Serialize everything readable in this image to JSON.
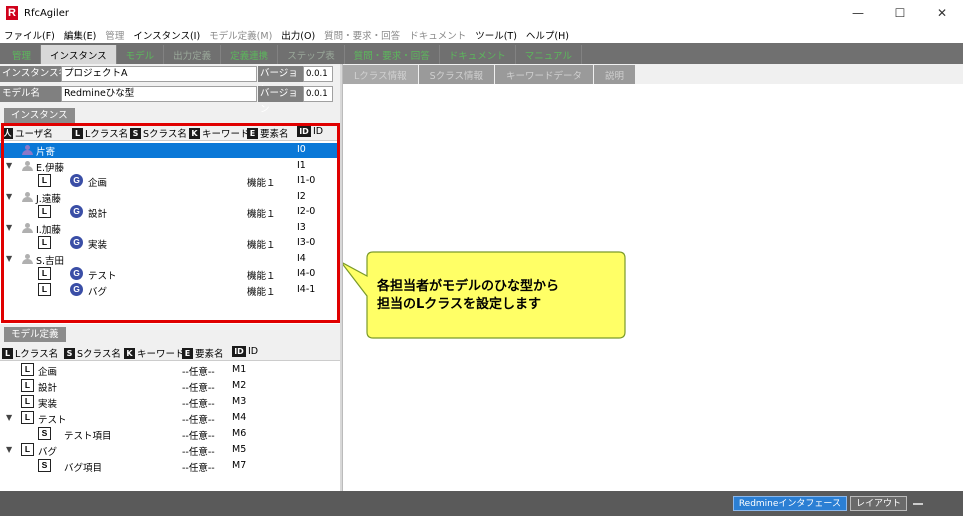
{
  "app": {
    "title": "RfcAgiler",
    "logo": "R"
  },
  "window_controls": {
    "minimize": "—",
    "maximize": "☐",
    "close": "✕"
  },
  "menu": [
    {
      "label": "ファイル(F)",
      "enabled": true
    },
    {
      "label": "編集(E)",
      "enabled": true
    },
    {
      "label": "管理",
      "enabled": false
    },
    {
      "label": "インスタンス(I)",
      "enabled": true
    },
    {
      "label": "モデル定義(M)",
      "enabled": false
    },
    {
      "label": "出力(O)",
      "enabled": true
    },
    {
      "label": "質問・要求・回答",
      "enabled": false
    },
    {
      "label": "ドキュメント",
      "enabled": false
    },
    {
      "label": "ツール(T)",
      "enabled": true
    },
    {
      "label": "ヘルプ(H)",
      "enabled": true
    }
  ],
  "tabs": [
    {
      "label": "管理",
      "style": "green"
    },
    {
      "label": "インスタンス",
      "style": "active"
    },
    {
      "label": "モデル",
      "style": "green"
    },
    {
      "label": "出力定義",
      "style": "dim"
    },
    {
      "label": "定義連携",
      "style": "green"
    },
    {
      "label": "ステップ表",
      "style": "dim"
    },
    {
      "label": "質問・要求・回答",
      "style": "green"
    },
    {
      "label": "ドキュメント",
      "style": "green"
    },
    {
      "label": "マニュアル",
      "style": "green"
    }
  ],
  "instance_form": {
    "instance_label": "インスタンス名",
    "instance_value": "プロジェクトA",
    "model_label": "モデル名",
    "model_value": "Redmineひな型",
    "version_label": "バージョン",
    "instance_version": "0.0.1",
    "model_version": "0.0.1"
  },
  "instance_section": {
    "tab_label": "インスタンス",
    "headers": {
      "user": {
        "icon": "人",
        "label": "ユーザ名"
      },
      "lclass": {
        "icon": "L",
        "label": "Lクラス名"
      },
      "sclass": {
        "icon": "S",
        "label": "Sクラス名"
      },
      "keyword": {
        "icon": "K",
        "label": "キーワード"
      },
      "element": {
        "icon": "E",
        "label": "要素名"
      },
      "id": {
        "icon": "ID",
        "label": "ID"
      }
    },
    "rows": [
      {
        "kind": "user",
        "name": "片寄",
        "id": "I0",
        "selected": true,
        "person": "purple",
        "expand": ""
      },
      {
        "kind": "user",
        "name": "E.伊藤",
        "id": "I1",
        "selected": false,
        "person": "grey",
        "expand": "▼"
      },
      {
        "kind": "item",
        "lclass": "L",
        "sclass": "G",
        "label": "企画",
        "element": "機能１",
        "id": "I1-0"
      },
      {
        "kind": "user",
        "name": "J.遠藤",
        "id": "I2",
        "selected": false,
        "person": "grey",
        "expand": "▼"
      },
      {
        "kind": "item",
        "lclass": "L",
        "sclass": "G",
        "label": "設計",
        "element": "機能１",
        "id": "I2-0"
      },
      {
        "kind": "user",
        "name": "I.加藤",
        "id": "I3",
        "selected": false,
        "person": "grey",
        "expand": "▼"
      },
      {
        "kind": "item",
        "lclass": "L",
        "sclass": "G",
        "label": "実装",
        "element": "機能１",
        "id": "I3-0"
      },
      {
        "kind": "user",
        "name": "S.吉田",
        "id": "I4",
        "selected": false,
        "person": "grey",
        "expand": "▼"
      },
      {
        "kind": "item",
        "lclass": "L",
        "sclass": "G",
        "label": "テスト",
        "element": "機能１",
        "id": "I4-0"
      },
      {
        "kind": "item",
        "lclass": "L",
        "sclass": "G",
        "label": "バグ",
        "element": "機能１",
        "id": "I4-1"
      }
    ]
  },
  "model_section": {
    "tab_label": "モデル定義",
    "headers": {
      "lclass": {
        "icon": "L",
        "label": "Lクラス名"
      },
      "sclass": {
        "icon": "S",
        "label": "Sクラス名"
      },
      "keyword": {
        "icon": "K",
        "label": "キーワード"
      },
      "element": {
        "icon": "E",
        "label": "要素名"
      },
      "id": {
        "icon": "ID",
        "label": "ID"
      }
    },
    "rows": [
      {
        "kind": "l",
        "label": "企画",
        "element": "--任意--",
        "id": "M1",
        "expand": ""
      },
      {
        "kind": "l",
        "label": "設計",
        "element": "--任意--",
        "id": "M2",
        "expand": ""
      },
      {
        "kind": "l",
        "label": "実装",
        "element": "--任意--",
        "id": "M3",
        "expand": ""
      },
      {
        "kind": "l",
        "label": "テスト",
        "element": "--任意--",
        "id": "M4",
        "expand": "▼"
      },
      {
        "kind": "s",
        "label": "テスト項目",
        "element": "--任意--",
        "id": "M6",
        "expand": ""
      },
      {
        "kind": "l",
        "label": "バグ",
        "element": "--任意--",
        "id": "M5",
        "expand": "▼"
      },
      {
        "kind": "s",
        "label": "バグ項目",
        "element": "--任意--",
        "id": "M7",
        "expand": ""
      }
    ]
  },
  "right_tabs": [
    "Lクラス情報",
    "Sクラス情報",
    "キーワードデータ",
    "説明"
  ],
  "callout": {
    "line1": "各担当者がモデルのひな型から",
    "line2": "担当のLクラスを設定します"
  },
  "status": {
    "redmine_button": "Redmineインタフェース",
    "layout_button": "レイアウト"
  },
  "colors": {
    "selected": "#0a78d7",
    "highlight_border": "#e00000",
    "callout_fill": "#ffff66",
    "callout_border": "#7a9a2a"
  }
}
